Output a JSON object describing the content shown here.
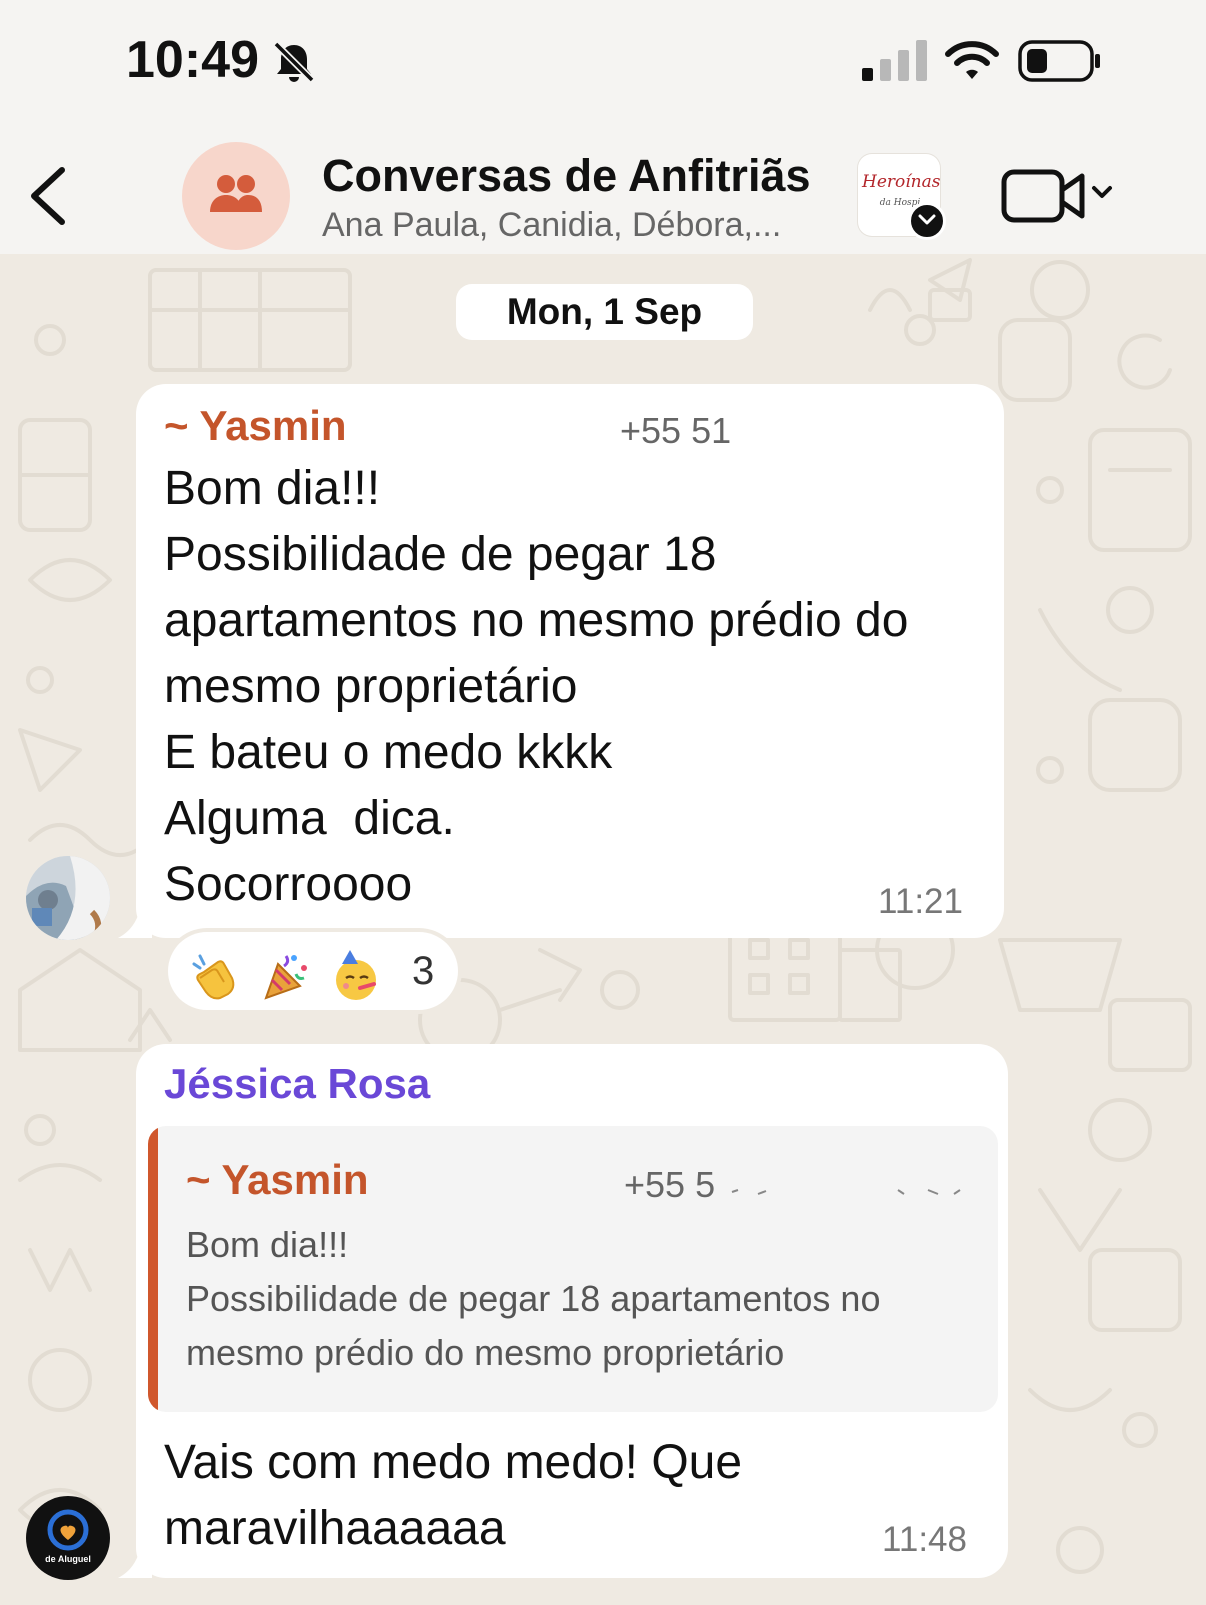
{
  "status_bar": {
    "time": "10:49"
  },
  "header": {
    "title": "Conversas de Anfitriãs",
    "subtitle": "Ana Paula, Canidia, Débora,...",
    "community_logo": {
      "script": "Heroínas",
      "sub": "da Hospi"
    }
  },
  "date_chip": "Mon, 1 Sep",
  "messages": [
    {
      "sender": "~ Yasmin",
      "phone": "+55 51",
      "lines": [
        "Bom dia!!!",
        "Possibilidade de pegar 18",
        "apartamentos no mesmo prédio do",
        "mesmo proprietário",
        "E bateu o medo kkkk",
        "Alguma  dica.",
        "Socorroooo"
      ],
      "time": "11:21",
      "reactions": {
        "emojis": [
          "clapping-hands",
          "party-popper",
          "partying-face"
        ],
        "count": "3"
      }
    },
    {
      "sender": "Jéssica Rosa",
      "quote": {
        "sender": "~ Yasmin",
        "phone": "+55 5",
        "lines": [
          "Bom dia!!!",
          "Possibilidade de pegar 18 apartamentos no",
          "mesmo prédio do mesmo proprietário"
        ]
      },
      "lines": [
        "Vais com medo medo! Que",
        "maravilhaaaaaa"
      ],
      "time": "11:48",
      "avatar_text": "de Aluguel"
    }
  ],
  "colors": {
    "yasmin_name": "#c4552b",
    "jessica_name": "#6a48d7",
    "quote_bar": "#d0572c",
    "wallpaper": "#efeae2",
    "bubble": "#ffffff",
    "group_avatar_bg": "#f7d6cb",
    "group_avatar_icon": "#d45c3c"
  },
  "icons": {
    "bell": "bell-slash-icon",
    "signal": "cellular-signal-icon",
    "wifi": "wifi-icon",
    "battery": "battery-icon",
    "back": "chevron-left-icon",
    "group": "people-icon",
    "video": "video-camera-icon"
  }
}
